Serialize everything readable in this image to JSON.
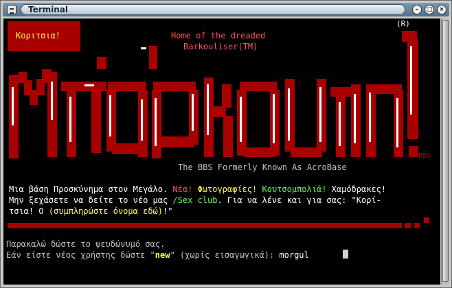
{
  "window": {
    "title": "Terminal",
    "controls": [
      "menu",
      "minimize",
      "maximize",
      "close"
    ]
  },
  "banner": {
    "badge": "Κοριτσια!",
    "home_line1": "Home of the dreaded",
    "home_line2": "Barkouliser(TM)",
    "trademark": "(R)",
    "logo_text": "Μπάρκουλης!",
    "bbs_tag": "BBS",
    "formerly": "The BBS Formerly Known As AcroBase"
  },
  "message": {
    "line1": {
      "a": "Μια βάση Προσκύνημα στον Μεγάλο.",
      "b": "Νέα!",
      "c": "Φωτογραφίες!",
      "d": "Κουτσομπολιά!",
      "e": "Χαμόδρακες!"
    },
    "line2": {
      "a": "Μην ξεχάσετε να δείτε το νέο μας",
      "b": "/Sex club",
      "c": ". Για να λένε και για σας: \"Κορί-"
    },
    "line3": {
      "a": "τσια! Ο",
      "b": "(συμπληρώστε όνομα εδώ)",
      "c": "!\""
    }
  },
  "prompt": {
    "line1": "Παρακαλώ δώστε το ψευδώνυμό σας.",
    "line2_a": "Εάν είστε νέος χρήστης δώστε \"",
    "line2_new": "new",
    "line2_b": "\" (χωρίς εισαγωγικά): ",
    "input_value": "morgul"
  },
  "colors": {
    "red": "#a80000",
    "bright_red": "#ff5555",
    "yellow": "#ffff55",
    "green": "#55ff55",
    "white": "#ffffff",
    "grey": "#c0c0c0"
  }
}
